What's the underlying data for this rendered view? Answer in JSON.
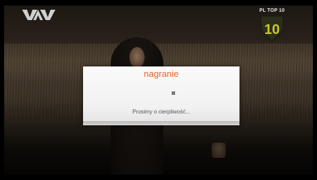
{
  "overlay": {
    "channel_logo_icon": "vivaa-channel-logo",
    "top10_badge": {
      "label": "PL TOP 10",
      "number": "10",
      "icon": "top10-badge-icon",
      "color": "#c8c832"
    }
  },
  "dialog": {
    "title": "nagranie",
    "message": "Prosimy o cierpliwość...",
    "spinner_icon": "loading-square-icon",
    "title_color": "#e8642a"
  }
}
